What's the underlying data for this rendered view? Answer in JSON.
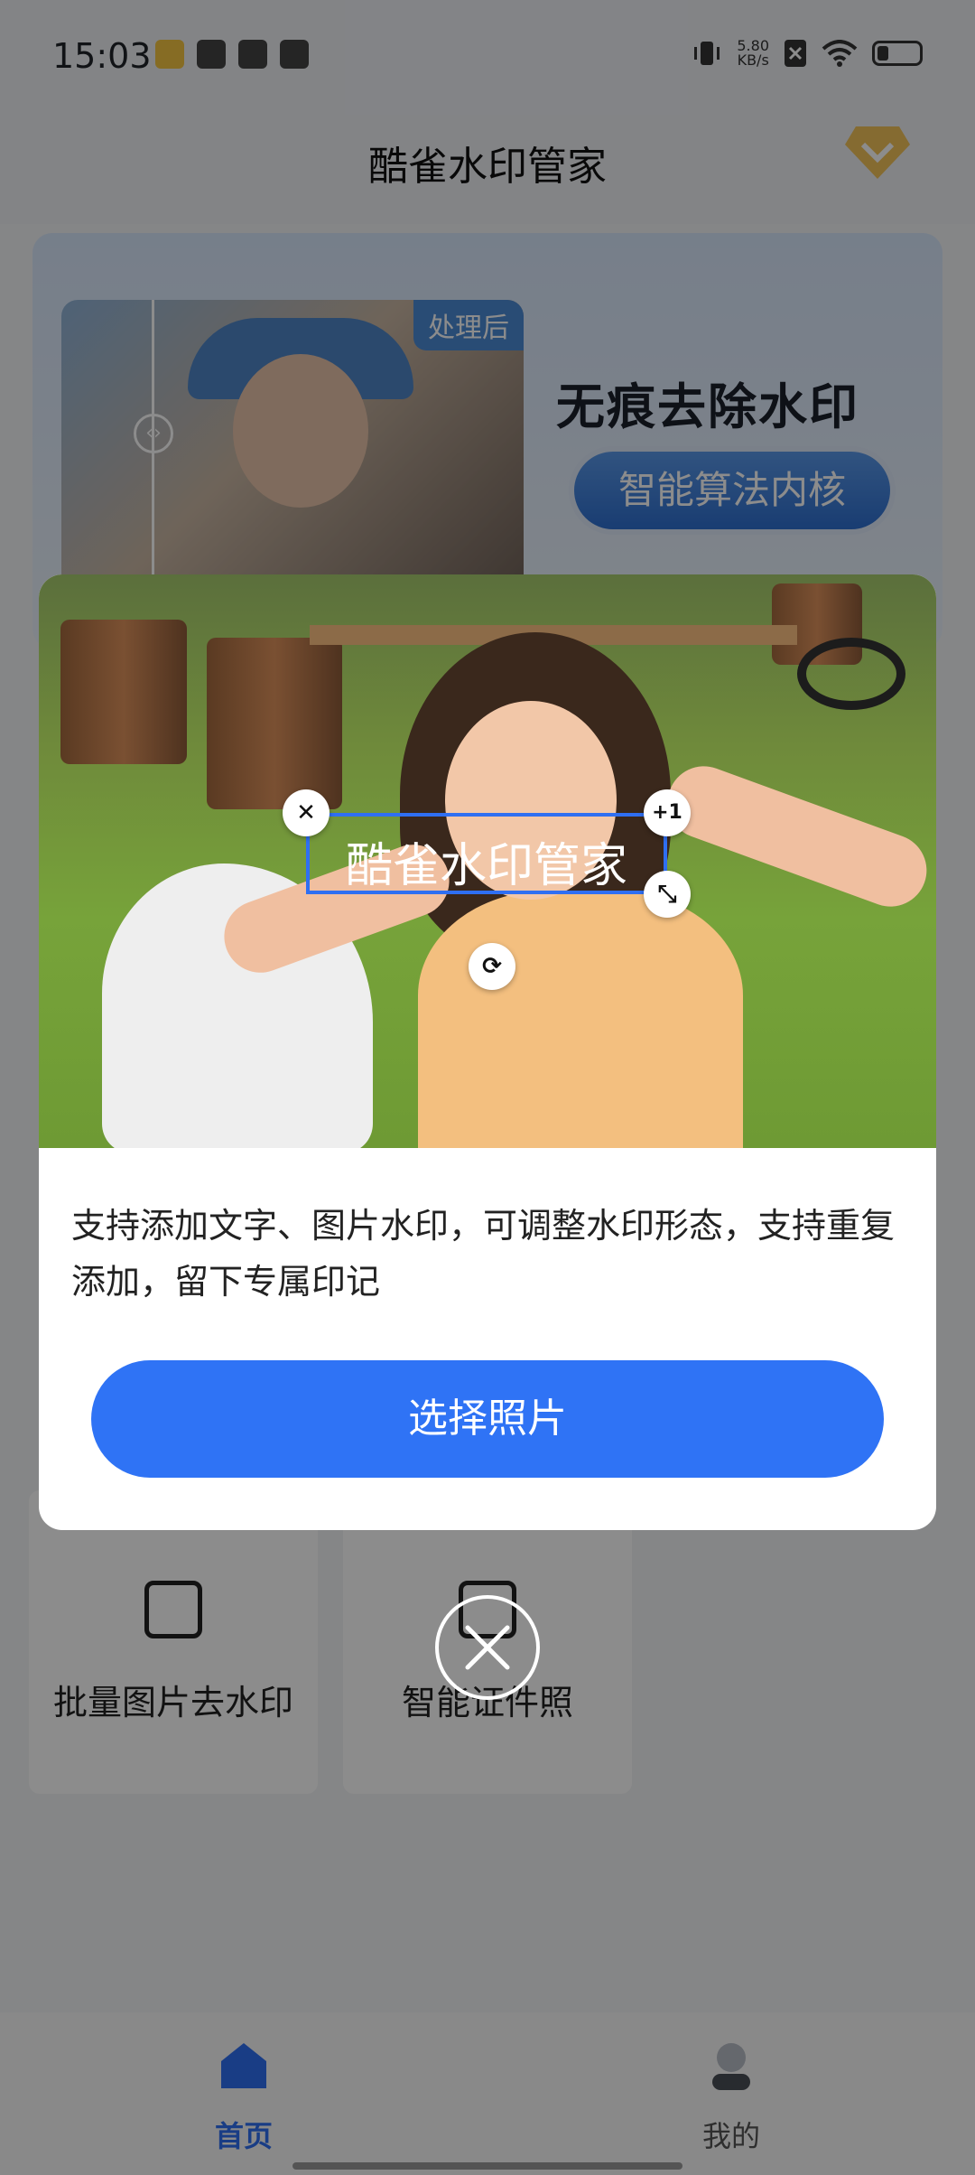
{
  "status_bar": {
    "time": "15:03",
    "net_speed_value": "5.80",
    "net_speed_unit": "KB/s"
  },
  "header": {
    "title": "酷雀水印管家",
    "vip_icon": "diamond-icon"
  },
  "banner": {
    "tag": "处理后",
    "headline": "无痕去除水印",
    "pill": "智能算法内核"
  },
  "tools": [
    {
      "label": "批量图片去水印",
      "icon": "batch-images-icon"
    },
    {
      "label": "智能证件照",
      "icon": "id-card-icon"
    }
  ],
  "modal": {
    "watermark_text": "酷雀水印管家",
    "plus_one": "+1",
    "description": "支持添加文字、图片水印，可调整水印形态，支持重复添加，留下专属印记",
    "cta": "选择照片"
  },
  "tabbar": {
    "home": "首页",
    "mine": "我的",
    "active_color": "#2f6ff2"
  }
}
